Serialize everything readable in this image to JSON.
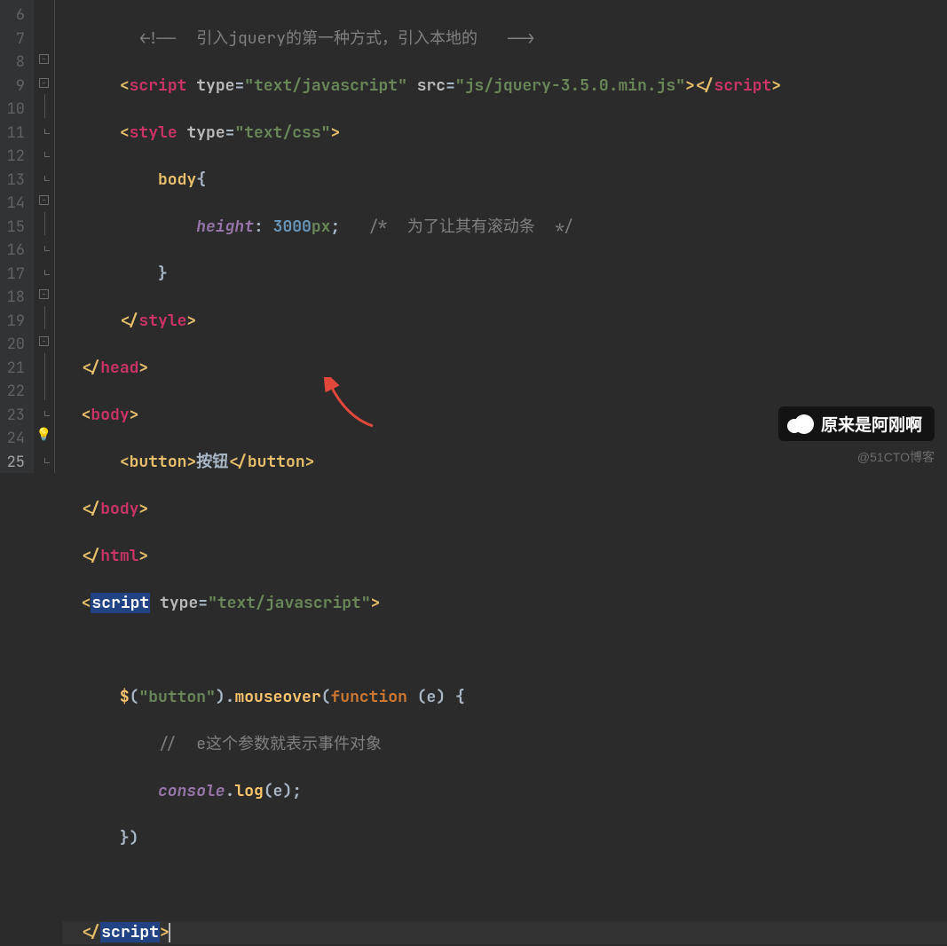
{
  "line_start": 6,
  "line_end": 25,
  "current_line": 25,
  "code": {
    "l6_comment": "<!--  引入jquery的第一种方式，引入本地的   -->",
    "l7": {
      "tag": "script",
      "attr_type": "type",
      "type": "\"text/javascript\"",
      "attr_src": "src",
      "src": "\"js/jquery-3.5.0.min.js\""
    },
    "l8": {
      "tag": "style",
      "attr_type": "type",
      "type": "\"text/css\""
    },
    "l9_sel": "body",
    "l9_brace": "{",
    "l10_prop": "height",
    "l10_colon": ":",
    "l10_num": "3000",
    "l10_unit": "px",
    "l10_semi": ";",
    "l10_cmt": "/*  为了让其有滚动条  */",
    "l11_brace": "}",
    "l12_close": "style",
    "l13_close": "head",
    "l14_open": "body",
    "l15_tag": "button",
    "l15_text": "按钮",
    "l16_close": "body",
    "l17_close": "html",
    "l18_tag": "script",
    "l18_attr_type": "type",
    "l18_type": "\"text/javascript\"",
    "l20_dollar": "$",
    "l20_arg": "\"button\"",
    "l20_method": "mouseover",
    "l20_kw": "function",
    "l20_param": "e",
    "l20_brace": "{",
    "l21_cmt": "//  e这个参数就表示事件对象",
    "l22_console": "console",
    "l22_log": "log",
    "l22_arg": "e",
    "l22_end": ");",
    "l23_close": "})",
    "l25_close": "script"
  },
  "watermark_main": "原来是阿刚啊",
  "watermark_sub": "@51CTO博客"
}
